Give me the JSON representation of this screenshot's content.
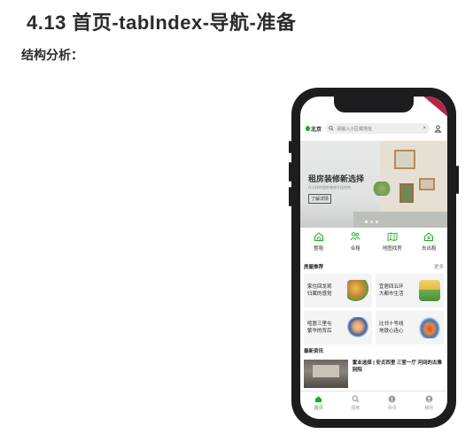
{
  "doc": {
    "title": "4.13 首页-tabIndex-导航-准备",
    "subtitle": "结构分析："
  },
  "app": {
    "city": "北京",
    "search_placeholder": "请输入小区或地址",
    "search_clear": "×",
    "banner": {
      "title": "租房装修新选择",
      "subtitle": "什么样的租房装修才适合你",
      "button": "了解详情"
    },
    "nav": [
      {
        "label": "整租",
        "icon": "home-icon"
      },
      {
        "label": "合租",
        "icon": "people-icon"
      },
      {
        "label": "地图找房",
        "icon": "map-icon"
      },
      {
        "label": "去出租",
        "icon": "house-key-icon"
      }
    ],
    "groups": {
      "title": "房屋推荐",
      "more": "更多",
      "items": [
        {
          "title": "家住回龙观",
          "desc": "归属的感觉"
        },
        {
          "title": "宜居四五环",
          "desc": "大都市生活"
        },
        {
          "title": "喧嚣三里屯",
          "desc": "繁华的背后"
        },
        {
          "title": "比邻十号线",
          "desc": "地铁心连心"
        }
      ]
    },
    "news": {
      "title": "最新资讯",
      "item_title": "置业选择 | 安贞西里 三室一厅 河间的古雅别院"
    },
    "tabbar": [
      {
        "label": "首页",
        "icon": "home-icon",
        "active": true
      },
      {
        "label": "找房",
        "icon": "search-icon",
        "active": false
      },
      {
        "label": "资讯",
        "icon": "info-icon",
        "active": false
      },
      {
        "label": "我的",
        "icon": "user-icon",
        "active": false
      }
    ],
    "colors": {
      "accent": "#1aad19",
      "phone": "#1d1d1f"
    }
  }
}
